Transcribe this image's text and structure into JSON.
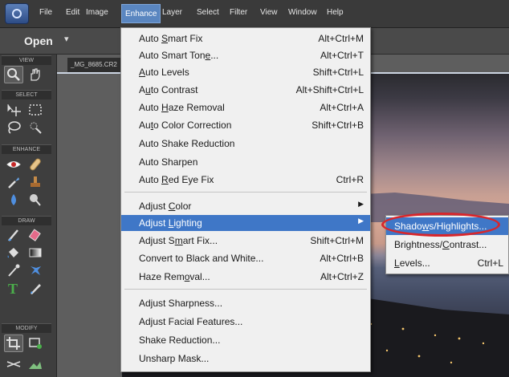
{
  "menubar": {
    "items": [
      {
        "label": "File"
      },
      {
        "label": "Edit"
      },
      {
        "label": "Image"
      },
      {
        "label": "Enhance"
      },
      {
        "label": "Layer"
      },
      {
        "label": "Select"
      },
      {
        "label": "Filter"
      },
      {
        "label": "View"
      },
      {
        "label": "Window"
      },
      {
        "label": "Help"
      }
    ],
    "active": "Enhance"
  },
  "openbar": {
    "open_label": "Open",
    "arrow": "▾"
  },
  "toolpanel": {
    "sections": [
      "VIEW",
      "SELECT",
      "ENHANCE",
      "DRAW",
      "MODIFY"
    ]
  },
  "document": {
    "tab_title": "_MG_8685.CR2"
  },
  "enhance_menu": {
    "items": [
      {
        "pre": "Auto ",
        "u": "S",
        "post": "mart Fix",
        "shortcut": "Alt+Ctrl+M"
      },
      {
        "pre": "Auto Smart Ton",
        "u": "e",
        "post": "...",
        "shortcut": "Alt+Ctrl+T"
      },
      {
        "pre": "",
        "u": "A",
        "post": "uto Levels",
        "shortcut": "Shift+Ctrl+L"
      },
      {
        "pre": "A",
        "u": "u",
        "post": "to Contrast",
        "shortcut": "Alt+Shift+Ctrl+L"
      },
      {
        "pre": "Auto ",
        "u": "H",
        "post": "aze Removal",
        "shortcut": "Alt+Ctrl+A"
      },
      {
        "pre": "Au",
        "u": "t",
        "post": "o Color Correction",
        "shortcut": "Shift+Ctrl+B"
      },
      {
        "pre": "Auto Shake Reduction",
        "u": "",
        "post": "",
        "shortcut": ""
      },
      {
        "pre": "Auto Sharpen",
        "u": "",
        "post": "",
        "shortcut": ""
      },
      {
        "pre": "Auto ",
        "u": "R",
        "post": "ed Eye Fix",
        "shortcut": "Ctrl+R"
      },
      {
        "pre": "Adjust ",
        "u": "C",
        "post": "olor",
        "shortcut": "",
        "submenu": "▶"
      },
      {
        "pre": "Adjust ",
        "u": "L",
        "post": "ighting",
        "shortcut": "",
        "submenu": "▶"
      },
      {
        "pre": "Adjust S",
        "u": "m",
        "post": "art Fix...",
        "shortcut": "Shift+Ctrl+M"
      },
      {
        "pre": "Convert to Black and White...",
        "u": "",
        "post": "",
        "shortcut": "Alt+Ctrl+B"
      },
      {
        "pre": "Haze Rem",
        "u": "o",
        "post": "val...",
        "shortcut": "Alt+Ctrl+Z"
      },
      {
        "pre": "Adjust Sharpness...",
        "u": "",
        "post": "",
        "shortcut": ""
      },
      {
        "pre": "Adjust Facial Features...",
        "u": "",
        "post": "",
        "shortcut": ""
      },
      {
        "pre": "Shake Reduction...",
        "u": "",
        "post": "",
        "shortcut": ""
      },
      {
        "pre": "Unsharp Mask...",
        "u": "",
        "post": "",
        "shortcut": ""
      }
    ],
    "highlighted": "Adjust Lighting"
  },
  "lighting_submenu": {
    "items": [
      {
        "pre": "Shado",
        "u": "w",
        "post": "s/Highlights...",
        "shortcut": ""
      },
      {
        "pre": "Brightness/",
        "u": "C",
        "post": "ontrast...",
        "shortcut": ""
      },
      {
        "pre": "",
        "u": "L",
        "post": "evels...",
        "shortcut": "Ctrl+L"
      }
    ],
    "highlighted": "Shadows/Highlights...",
    "annotation_color": "#d8262b"
  },
  "colors": {
    "highlight": "#3f77c7",
    "menu_bg": "#f0f0f0",
    "annotation": "#d8262b"
  }
}
